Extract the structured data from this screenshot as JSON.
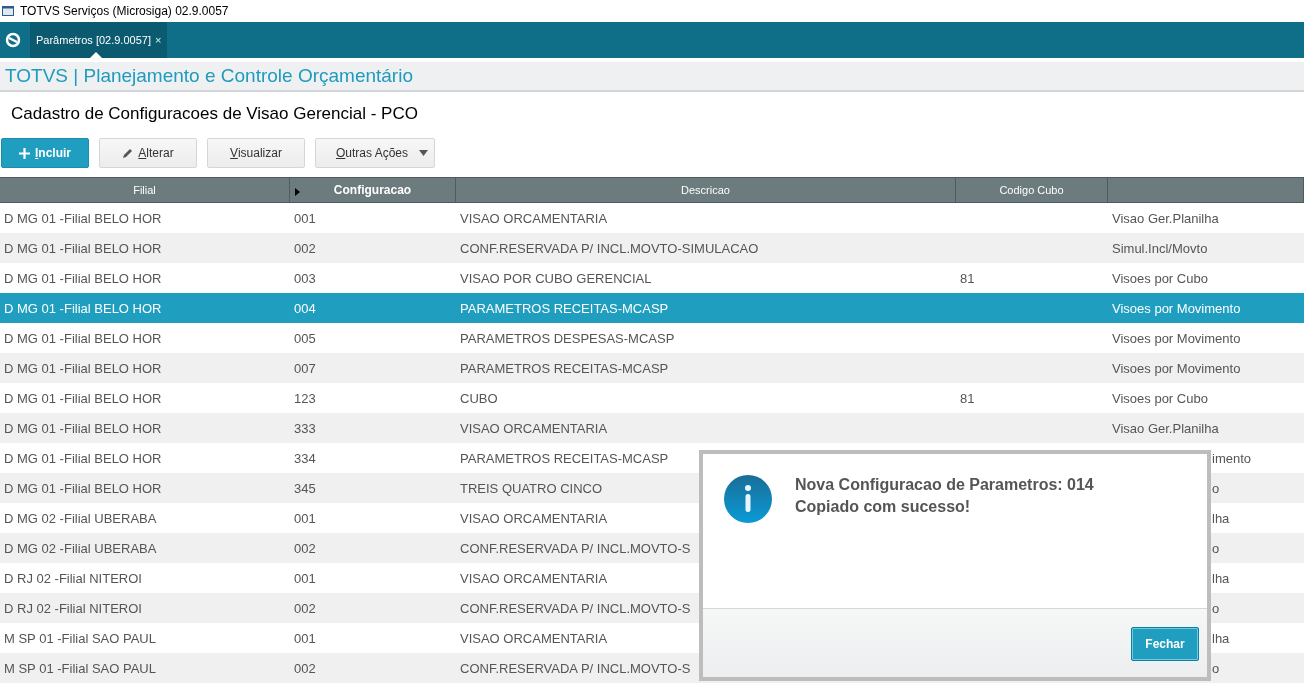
{
  "window": {
    "title": "TOTVS Serviços (Microsiga) 02.9.0057"
  },
  "tabs": [
    {
      "label": "Parâmetros [02.9.0057]",
      "close": "×",
      "selected": true
    }
  ],
  "app_header": {
    "title": "TOTVS | Planejamento e Controle Orçamentário"
  },
  "page_title": "Cadastro de Configuracoes de Visao Gerencial - PCO",
  "toolbar": [
    {
      "label": "Incluir",
      "kind": "primary"
    },
    {
      "label": "Alterar",
      "kind": "edit"
    },
    {
      "label": "Visualizar",
      "kind": "default"
    },
    {
      "label": "Outras Ações",
      "kind": "dropdown"
    }
  ],
  "table": {
    "columns": [
      {
        "label": "Filial",
        "sorted": false
      },
      {
        "label": "Configuracao",
        "sorted": true
      },
      {
        "label": "Descricao",
        "sorted": false
      },
      {
        "label": "Codigo Cubo",
        "sorted": false
      },
      {
        "sorted": false
      }
    ],
    "rows": [
      {
        "cells": [
          "D MG 01 -Filial BELO HOR",
          "001",
          "VISAO ORCAMENTARIA",
          "",
          "Visao Ger.Planilha"
        ],
        "selected": false,
        "covered": false
      },
      {
        "cells": [
          "D MG 01 -Filial BELO HOR",
          "002",
          "CONF.RESERVADA P/ INCL.MOVTO-SIMULACAO",
          "",
          "Simul.Incl/Movto"
        ],
        "selected": false,
        "covered": false
      },
      {
        "cells": [
          "D MG 01 -Filial BELO HOR",
          "003",
          "VISAO POR CUBO GERENCIAL",
          "81",
          "Visoes por Cubo"
        ],
        "selected": false,
        "covered": false
      },
      {
        "cells": [
          "D MG 01 -Filial BELO HOR",
          "004",
          "PARAMETROS RECEITAS-MCASP",
          "",
          "Visoes por Movimento"
        ],
        "selected": true,
        "covered": false
      },
      {
        "cells": [
          "D MG 01 -Filial BELO HOR",
          "005",
          "PARAMETROS DESPESAS-MCASP",
          "",
          "Visoes por Movimento"
        ],
        "selected": false,
        "covered": false
      },
      {
        "cells": [
          "D MG 01 -Filial BELO HOR",
          "007",
          "PARAMETROS RECEITAS-MCASP",
          "",
          "Visoes por Movimento"
        ],
        "selected": false,
        "covered": false
      },
      {
        "cells": [
          "D MG 01 -Filial BELO HOR",
          "123",
          "CUBO",
          "81",
          "Visoes por Cubo"
        ],
        "selected": false,
        "covered": false
      },
      {
        "cells": [
          "D MG 01 -Filial BELO HOR",
          "333",
          "VISAO ORCAMENTARIA",
          "",
          "Visao Ger.Planilha"
        ],
        "selected": false,
        "covered": false
      },
      {
        "cells": [
          "D MG 01 -Filial BELO HOR",
          "334",
          "PARAMETROS RECEITAS-MCASP",
          "",
          "imento"
        ],
        "selected": false,
        "covered": true
      },
      {
        "cells": [
          "D MG 01 -Filial BELO HOR",
          "345",
          "TREIS QUATRO CINCO",
          "",
          "o"
        ],
        "selected": false,
        "covered": true
      },
      {
        "cells": [
          "D MG 02 -Filial UBERABA",
          "001",
          "VISAO ORCAMENTARIA",
          "",
          "lha"
        ],
        "selected": false,
        "covered": true
      },
      {
        "cells": [
          "D MG 02 -Filial UBERABA",
          "002",
          "CONF.RESERVADA P/ INCL.MOVTO-S",
          "",
          "o"
        ],
        "selected": false,
        "covered": true
      },
      {
        "cells": [
          "D RJ 02 -Filial NITEROI",
          "001",
          "VISAO ORCAMENTARIA",
          "",
          "lha"
        ],
        "selected": false,
        "covered": true
      },
      {
        "cells": [
          "D RJ 02 -Filial NITEROI",
          "002",
          "CONF.RESERVADA P/ INCL.MOVTO-S",
          "",
          "o"
        ],
        "selected": false,
        "covered": true
      },
      {
        "cells": [
          "M SP 01 -Filial SAO PAUL",
          "001",
          "VISAO ORCAMENTARIA",
          "",
          "lha"
        ],
        "selected": false,
        "covered": true
      },
      {
        "cells": [
          "M SP 01 -Filial SAO PAUL",
          "002",
          "CONF.RESERVADA P/ INCL.MOVTO-S",
          "",
          "o"
        ],
        "selected": false,
        "covered": true
      }
    ]
  },
  "dialog": {
    "message": "Nova Configuracao de Parametros: 014",
    "detail": "Copiado com sucesso!",
    "button": "Fechar"
  }
}
